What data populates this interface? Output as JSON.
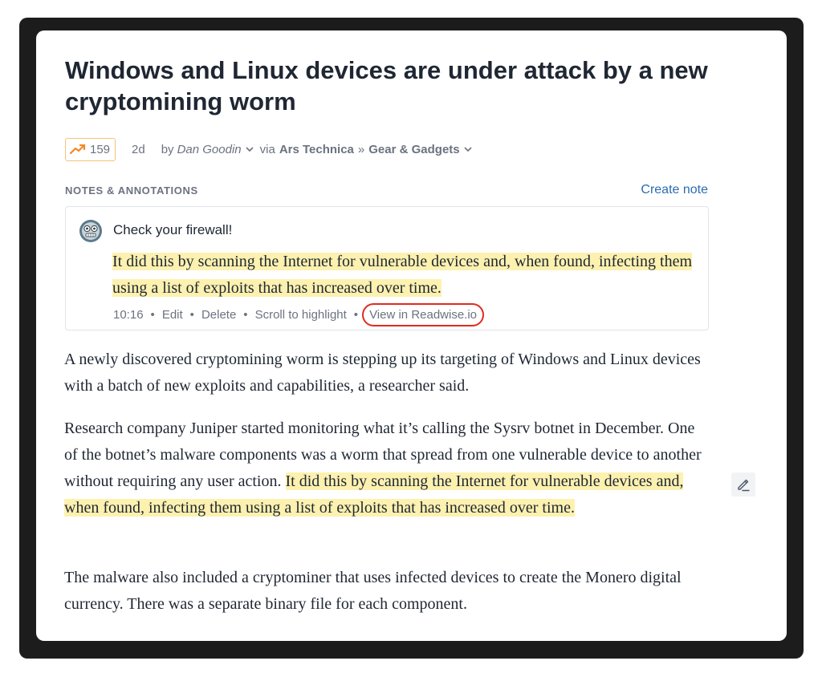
{
  "article": {
    "title": "Windows and Linux devices are under attack by a new cryptomining worm",
    "trend_count": "159",
    "age": "2d",
    "by_label": "by",
    "author": "Dan Goodin",
    "via_label": "via",
    "source": "Ars Technica",
    "separator": "»",
    "section": "Gear & Gadgets",
    "paragraphs": [
      "A newly discovered cryptomining worm is stepping up its targeting of Windows and Linux devices with a batch of new exploits and capabilities, a researcher said.",
      "Research company Juniper started monitoring what it’s calling the Sysrv botnet in December. One of the botnet’s malware components was a worm that spread from one vulnerable device to another without requiring any user action. ",
      "It did this by scanning the Internet for vulnerable devices and, when found, infecting them using a list of exploits that has increased over time.",
      "The malware also included a cryptominer that uses infected devices to create the Monero digital currency. There was a separate binary file for each component."
    ]
  },
  "notes": {
    "section_label": "NOTES & ANNOTATIONS",
    "create_label": "Create note",
    "note": {
      "text": "Check your firewall!",
      "highlight": "It did this by scanning the Internet for vulnerable devices and, when found, infecting them using a list of exploits that has increased over time.",
      "time": "10:16",
      "edit_label": "Edit",
      "delete_label": "Delete",
      "scroll_label": "Scroll to highlight",
      "view_label": "View in Readwise.io",
      "dot": "•"
    }
  },
  "colors": {
    "highlight": "#fdf1b0",
    "link": "#2b6cb0",
    "trend_accent": "#f08a24",
    "callout": "#e02b1f"
  },
  "icons": [
    "trending-up-icon",
    "chevron-down-icon",
    "avatar",
    "highlighter-icon"
  ]
}
